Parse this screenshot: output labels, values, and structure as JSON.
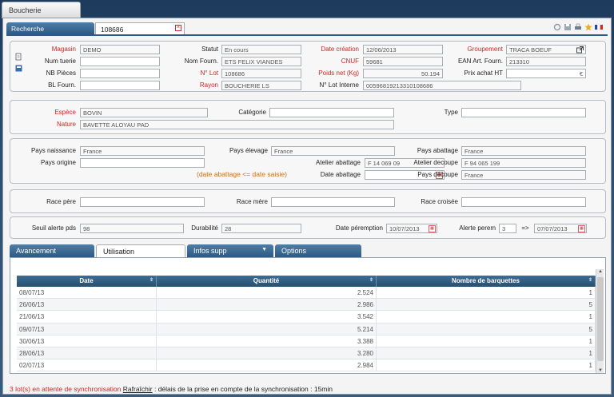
{
  "window": {
    "title": "Boucherie"
  },
  "tabs": {
    "search": "Recherche",
    "lot": "108686"
  },
  "header": {
    "magasin_label": "Magasin",
    "magasin": "DEMO",
    "num_tuerie_label": "Num tuerie",
    "num_tuerie": "",
    "nb_pieces_label": "NB Pièces",
    "nb_pieces": "",
    "bl_fourn_label": "BL Fourn.",
    "bl_fourn": "",
    "statut_label": "Statut",
    "statut": "En cours",
    "nom_fourn_label": "Nom Fourn.",
    "nom_fourn": "ETS FELIX VIANDES",
    "num_lot_label": "N° Lot",
    "num_lot": "108686",
    "rayon_label": "Rayon",
    "rayon": "BOUCHERIE LS",
    "date_creation_label": "Date création",
    "date_creation": "12/06/2013",
    "cnuf_label": "CNUF",
    "cnuf": "59681",
    "poids_net_label": "Poids net (Kg)",
    "poids_net": "50.194",
    "lot_interne_label": "N° Lot Interne",
    "lot_interne": "00596819213310108686",
    "groupement_label": "Groupement",
    "groupement": "TRACA BOEUF",
    "ean_label": "EAN Art. Fourn.",
    "ean": "213310",
    "prix_achat_label": "Prix achat HT",
    "prix_achat": "",
    "currency": "€"
  },
  "species": {
    "espece_label": "Espèce",
    "espece": "BOVIN",
    "nature_label": "Nature",
    "nature": "BAVETTE ALOYAU PAD",
    "categorie_label": "Catégorie",
    "categorie": "",
    "type_label": "Type",
    "type": ""
  },
  "origin": {
    "pays_naissance_label": "Pays naissance",
    "pays_naissance": "France",
    "pays_origine_label": "Pays origine",
    "pays_origine": "",
    "pays_elevage_label": "Pays élevage",
    "pays_elevage": "France",
    "atelier_abattage_label": "Atelier abattage",
    "atelier_abattage": "F 14 069 09",
    "date_abattage_label": "Date abattage",
    "date_abattage": "",
    "pays_abattage_label": "Pays abattage",
    "pays_abattage": "France",
    "atelier_decoupe_label": "Atelier decoupe",
    "atelier_decoupe": "F 94 065 199",
    "pays_decoupe_label": "Pays découpe",
    "pays_decoupe": "France",
    "note": "(date abattage <= date saisie)"
  },
  "race": {
    "race_pere_label": "Race père",
    "race_pere": "",
    "race_mere_label": "Race mère",
    "race_mere": "",
    "race_croisee_label": "Race croisée",
    "race_croisee": ""
  },
  "alert": {
    "seuil_label": "Seuil alerte pds",
    "seuil": "98",
    "durabilite_label": "Durabilité",
    "durabilite": "28",
    "date_peremption_label": "Date péremption",
    "date_peremption": "10/07/2013",
    "alerte_perem_label": "Alerte perem",
    "alerte_perem": "3",
    "arrow": "=>",
    "alerte_date": "07/07/2013"
  },
  "subtabs": {
    "avancement": "Avancement",
    "utilisation": "Utilisation",
    "infos_supp": "Infos supp",
    "options": "Options"
  },
  "grid": {
    "columns": [
      "Date",
      "Quantité",
      "Nombre de barquettes"
    ],
    "rows": [
      [
        "08/07/13",
        "2.524",
        "1"
      ],
      [
        "26/06/13",
        "2.986",
        "5"
      ],
      [
        "21/06/13",
        "3.542",
        "1"
      ],
      [
        "09/07/13",
        "5.214",
        "5"
      ],
      [
        "30/06/13",
        "3.388",
        "1"
      ],
      [
        "28/06/13",
        "3.280",
        "1"
      ],
      [
        "02/07/13",
        "2.984",
        "1"
      ]
    ]
  },
  "status": {
    "pending": "3 lot(s) en attente de synchronisation",
    "refresh": "Rafraîchir",
    "delay": ": délais de la prise en compte de la synchronisation : 15min"
  }
}
